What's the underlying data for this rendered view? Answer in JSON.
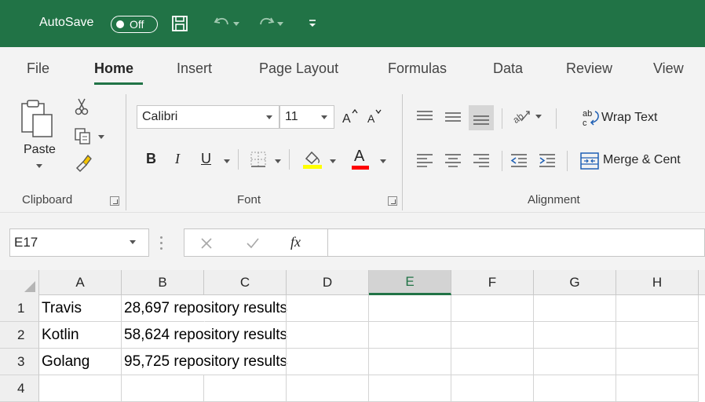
{
  "titlebar": {
    "autosave_label": "AutoSave",
    "autosave_state": "Off",
    "icons": [
      "save-icon",
      "undo-icon",
      "redo-icon",
      "customize-qat-icon"
    ]
  },
  "tabs": [
    "File",
    "Home",
    "Insert",
    "Page Layout",
    "Formulas",
    "Data",
    "Review",
    "View"
  ],
  "active_tab": "Home",
  "ribbon": {
    "clipboard": {
      "paste_label": "Paste",
      "group_label": "Clipboard"
    },
    "font": {
      "font_name": "Calibri",
      "font_size": "11",
      "bold": "B",
      "italic": "I",
      "underline": "U",
      "font_color_letter": "A",
      "group_label": "Font"
    },
    "alignment": {
      "wrap_text": "Wrap Text",
      "merge_center": "Merge & Cent",
      "group_label": "Alignment"
    }
  },
  "formula_bar": {
    "name_box": "E17",
    "fx_label": "fx",
    "formula": ""
  },
  "grid": {
    "columns": [
      "A",
      "B",
      "C",
      "D",
      "E",
      "F",
      "G",
      "H"
    ],
    "selected_column": "E",
    "rows": [
      {
        "num": "1",
        "a": "Travis",
        "b": "28,697 repository results"
      },
      {
        "num": "2",
        "a": "Kotlin",
        "b": "58,624 repository results"
      },
      {
        "num": "3",
        "a": "Golang",
        "b": "95,725 repository results"
      },
      {
        "num": "4",
        "a": "",
        "b": ""
      }
    ]
  },
  "colors": {
    "brand_green": "#217346",
    "ribbon_bg": "#f3f3f3",
    "font_highlight": "#ffff00",
    "font_color": "#ff0000"
  }
}
